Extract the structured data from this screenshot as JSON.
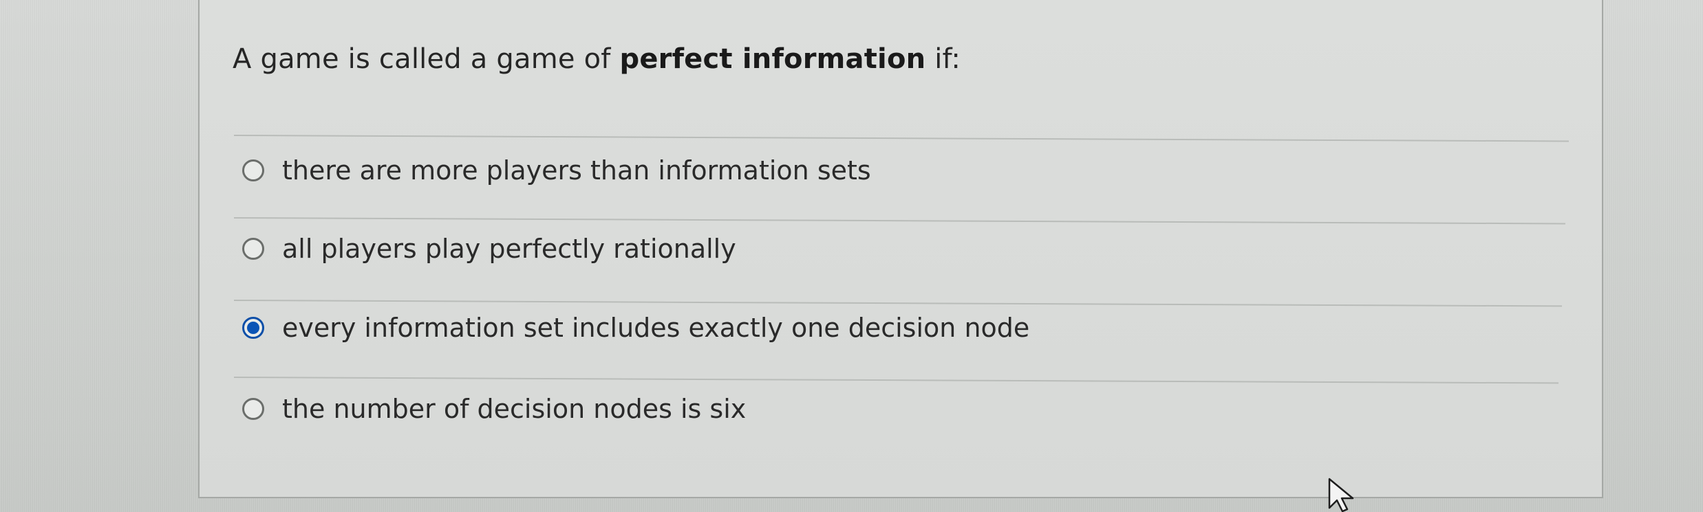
{
  "question": {
    "prefix": "A game is called a game of ",
    "emphasis": "perfect information",
    "suffix": " if:"
  },
  "options": [
    {
      "label": "there are more players than information sets",
      "selected": false
    },
    {
      "label": "all players play perfectly rationally",
      "selected": false
    },
    {
      "label": "every information set includes exactly one decision node",
      "selected": true
    },
    {
      "label": "the number of decision nodes is six",
      "selected": false
    }
  ],
  "colors": {
    "radio_selected": "#0b54b6",
    "radio_border": "#6b6e6b",
    "card_background": "#d9dbd9"
  },
  "icons": {
    "cursor": "mouse-pointer-icon"
  }
}
